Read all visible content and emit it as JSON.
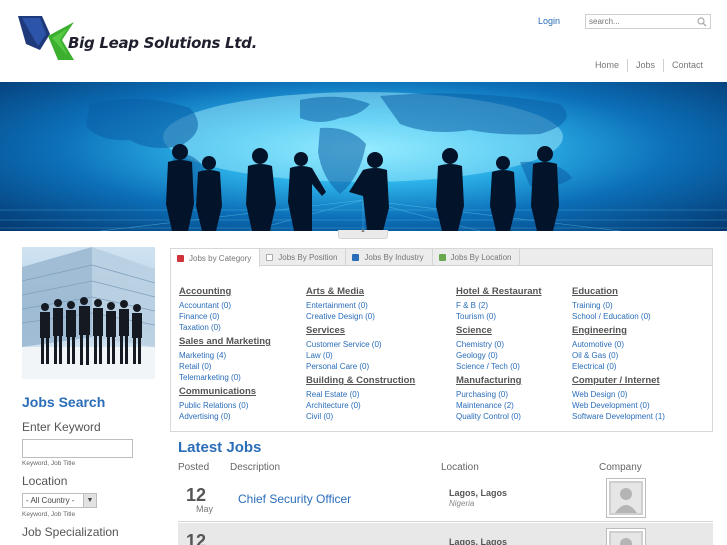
{
  "header": {
    "brand": "Big Leap Solutions Ltd.",
    "login": "Login",
    "search_placeholder": "search...",
    "nav": [
      "Home",
      "Jobs",
      "Contact"
    ]
  },
  "tabs": [
    {
      "label": "Jobs by Category",
      "color": "#d0343a"
    },
    {
      "label": "Jobs By Position",
      "color": "#bdbdbd"
    },
    {
      "label": "Jobs By Industry",
      "color": "#2a6db8"
    },
    {
      "label": "Jobs By Location",
      "color": "#6aa84f"
    }
  ],
  "categories": [
    [
      {
        "name": "Accounting",
        "items": [
          "Accountant (0)",
          "Finance (0)",
          "Taxation (0)"
        ]
      },
      {
        "name": "Sales and Marketing",
        "items": [
          "Marketing (4)",
          "Retail (0)",
          "Telemarketing (0)"
        ]
      },
      {
        "name": "Communications",
        "items": [
          "Public Relations (0)",
          "Advertising (0)"
        ]
      }
    ],
    [
      {
        "name": "Arts & Media",
        "items": [
          "Entertainment (0)",
          "Creative Design (0)"
        ]
      },
      {
        "name": "Services",
        "items": [
          "Customer Service (0)",
          "Law (0)",
          "Personal Care (0)"
        ]
      },
      {
        "name": "Building & Construction",
        "items": [
          "Real Estate (0)",
          "Architecture (0)",
          "Civil (0)"
        ]
      }
    ],
    [
      {
        "name": "Hotel & Restaurant",
        "items": [
          "F & B (2)",
          "Tourism (0)"
        ]
      },
      {
        "name": "Science",
        "items": [
          "Chemistry (0)",
          "Geology (0)",
          "Science / Tech (0)"
        ]
      },
      {
        "name": "Manufacturing",
        "items": [
          "Purchasing (0)",
          "Maintenance (2)",
          "Quality Control (0)"
        ]
      }
    ],
    [
      {
        "name": "Education",
        "items": [
          "Training (0)",
          "School / Education (0)"
        ]
      },
      {
        "name": "Engineering",
        "items": [
          "Automotive (0)",
          "Oil & Gas (0)",
          "Electrical (0)"
        ]
      },
      {
        "name": "Computer / Internet",
        "items": [
          "Web Design (0)",
          "Web Development (0)",
          "Software Development (1)"
        ]
      }
    ]
  ],
  "sidebar": {
    "title": "Jobs Search",
    "keyword_label": "Enter Keyword",
    "keyword_hint": "Keyword, Job Title",
    "location_label": "Location",
    "country_select": "- All Country -",
    "location_hint": "Keyword, Job Title",
    "specialization_label": "Job Specialization"
  },
  "latest": {
    "title": "Latest Jobs",
    "columns": {
      "posted": "Posted",
      "description": "Description",
      "location": "Location",
      "company": "Company"
    },
    "rows": [
      {
        "day": "12",
        "month": "May",
        "title": "Chief Security Officer",
        "city": "Lagos, Lagos",
        "country": "Nigeria"
      },
      {
        "day": "12",
        "month": "",
        "title": "",
        "city": "Lagos, Lagos",
        "country": ""
      }
    ]
  }
}
